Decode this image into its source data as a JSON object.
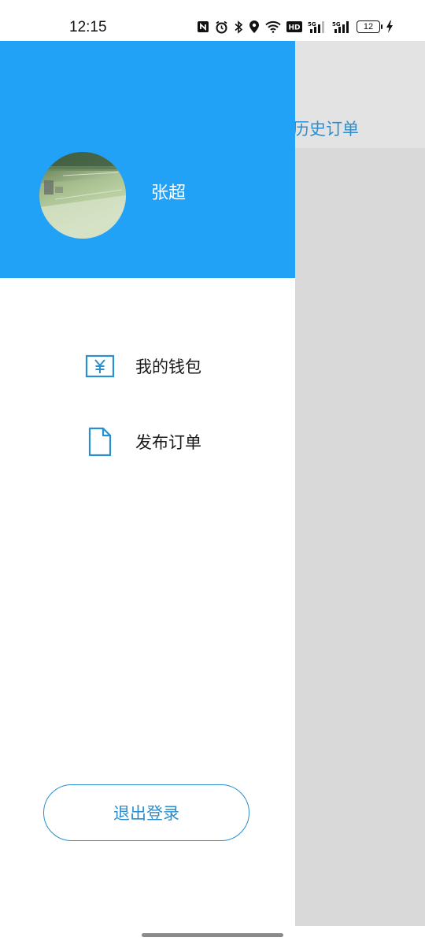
{
  "status_bar": {
    "time": "12:15",
    "battery_level": "12",
    "network_badge_1": "HD",
    "network_badge_2": "5G",
    "network_badge_3": "5G",
    "icons": [
      "nfc-icon",
      "alarm-icon",
      "bluetooth-icon",
      "location-icon",
      "wifi-icon",
      "hd-icon",
      "signal-5g-icon",
      "signal-5g-icon",
      "battery-icon",
      "charging-icon"
    ]
  },
  "background_page": {
    "tab_label": "历史订单"
  },
  "drawer": {
    "user_name": "张超",
    "menu": [
      {
        "label": "我的钱包",
        "icon": "wallet-yen-icon"
      },
      {
        "label": "发布订单",
        "icon": "document-icon"
      }
    ],
    "logout_label": "退出登录"
  },
  "colors": {
    "header_blue": "#21a2f7",
    "accent_blue": "#2a8fcf",
    "overlay_gray": "#d9d9d9"
  }
}
